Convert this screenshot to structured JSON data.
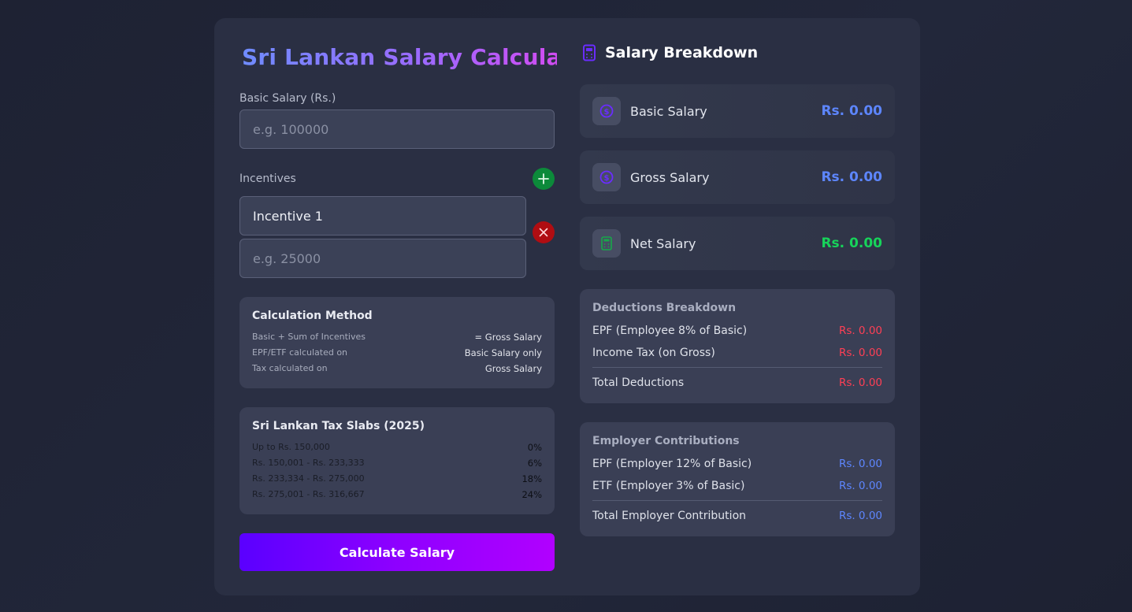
{
  "calculator": {
    "title": "Sri Lankan Salary Calculator",
    "basic_salary_label": "Basic Salary (Rs.)",
    "basic_salary_placeholder": "e.g. 100000",
    "incentives_label": "Incentives",
    "incentive": {
      "name": "Incentive 1",
      "amount_placeholder": "e.g. 25000"
    },
    "method": {
      "title": "Calculation Method",
      "rows": [
        {
          "key": "Basic + Sum of Incentives",
          "value": "= Gross Salary"
        },
        {
          "key": "EPF/ETF calculated on",
          "value": "Basic Salary only"
        },
        {
          "key": "Tax calculated on",
          "value": "Gross Salary"
        }
      ]
    },
    "tax_slabs": {
      "title": "Sri Lankan Tax Slabs (2025)",
      "rows": [
        {
          "range": "Up to Rs. 150,000",
          "rate": "0%"
        },
        {
          "range": "Rs. 150,001 - Rs. 233,333",
          "rate": "6%"
        },
        {
          "range": "Rs. 233,334 - Rs. 275,000",
          "rate": "18%"
        },
        {
          "range": "Rs. 275,001 - Rs. 316,667",
          "rate": "24%"
        }
      ]
    },
    "calculate_button": "Calculate Salary"
  },
  "breakdown": {
    "title": "Salary Breakdown",
    "summary": [
      {
        "label": "Basic Salary",
        "value": "Rs. 0.00",
        "icon": "dollar-coin-icon",
        "color": "#5d86ff"
      },
      {
        "label": "Gross Salary",
        "value": "Rs. 0.00",
        "icon": "dollar-coin-icon",
        "color": "#5d86ff"
      },
      {
        "label": "Net Salary",
        "value": "Rs. 0.00",
        "icon": "calculator-icon",
        "color": "#17d35a"
      }
    ],
    "deductions": {
      "title": "Deductions Breakdown",
      "rows": [
        {
          "label": "EPF (Employee 8% of Basic)",
          "value": "Rs. 0.00"
        },
        {
          "label": "Income Tax (on Gross)",
          "value": "Rs. 0.00"
        }
      ],
      "total_label": "Total Deductions",
      "total_value": "Rs. 0.00"
    },
    "employer": {
      "title": "Employer Contributions",
      "rows": [
        {
          "label": "EPF (Employer 12% of Basic)",
          "value": "Rs. 0.00"
        },
        {
          "label": "ETF (Employer 3% of Basic)",
          "value": "Rs. 0.00"
        }
      ],
      "total_label": "Total Employer Contribution",
      "total_value": "Rs. 0.00"
    }
  },
  "colors": {
    "accent_blue": "#5d86ff",
    "net_green": "#17d35a",
    "deduction_red": "#ff3f55",
    "add_green": "#0c8a3a",
    "remove_red": "#b00d12",
    "button_gradient_start": "#5a00ff",
    "button_gradient_end": "#b100ff"
  }
}
